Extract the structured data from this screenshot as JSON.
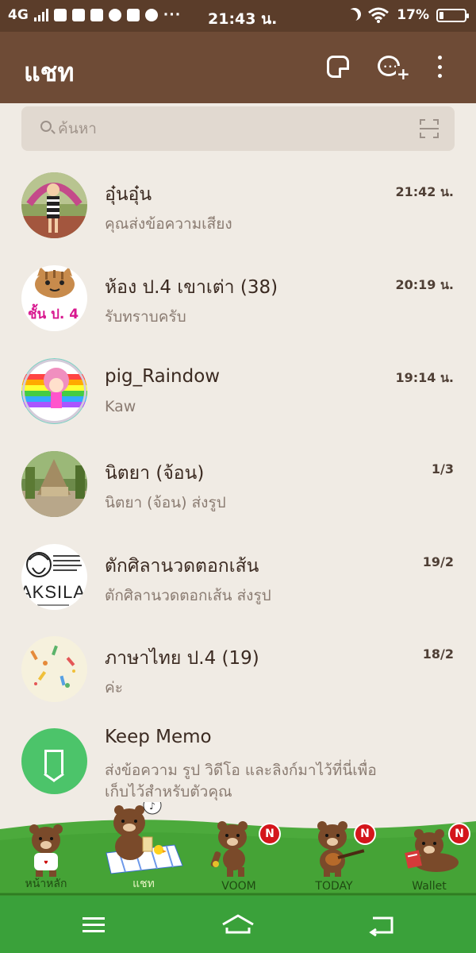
{
  "status_bar": {
    "network": "4G",
    "time": "21:43 น.",
    "battery": "17%"
  },
  "header": {
    "title": "แชท",
    "icons": [
      "note-icon",
      "add-chat-icon",
      "more-icon"
    ]
  },
  "search": {
    "placeholder": "ค้นหา"
  },
  "chats": [
    {
      "name": "อุ๋นอุ๋น",
      "message": "คุณส่งข้อความเสียง",
      "time": "21:42 น."
    },
    {
      "name": "ห้อง ป.4 เขาเต่า (38)",
      "message": "รับทราบครับ",
      "time": "20:19 น.",
      "avatar_text": "ชั้น ป. 4"
    },
    {
      "name": "pig_Raindow",
      "message": "Kaw",
      "time": "19:14 น."
    },
    {
      "name": "นิตยา (จ้อน)",
      "message": "นิตยา (จ้อน) ส่งรูป",
      "time": "1/3"
    },
    {
      "name": "ตักศิลานวดตอกเส้น",
      "message": "ตักศิลานวดตอกเส้น ส่งรูป",
      "time": "19/2",
      "avatar_text": "AKSILA"
    },
    {
      "name": "ภาษาไทย ป.4 (19)",
      "message": "ค่ะ",
      "time": "18/2"
    }
  ],
  "keep_memo": {
    "name": "Keep Memo",
    "message": "ส่งข้อความ รูป วิดีโอ และลิงก์มาไว้ที่นี่เพื่อเก็บไว้สำหรับตัวคุณ"
  },
  "tabs": [
    {
      "label": "หน้าหลัก",
      "badge": ""
    },
    {
      "label": "แชท",
      "badge": ""
    },
    {
      "label": "VOOM",
      "badge": "N"
    },
    {
      "label": "TODAY",
      "badge": "N"
    },
    {
      "label": "Wallet",
      "badge": "N"
    }
  ],
  "colors": {
    "status_bar": "#5b3d2a",
    "header": "#6e4b36",
    "background": "#f0ebe4",
    "grass": "#4caa3c",
    "badge": "#d4151b",
    "memo": "#4cc46a"
  }
}
